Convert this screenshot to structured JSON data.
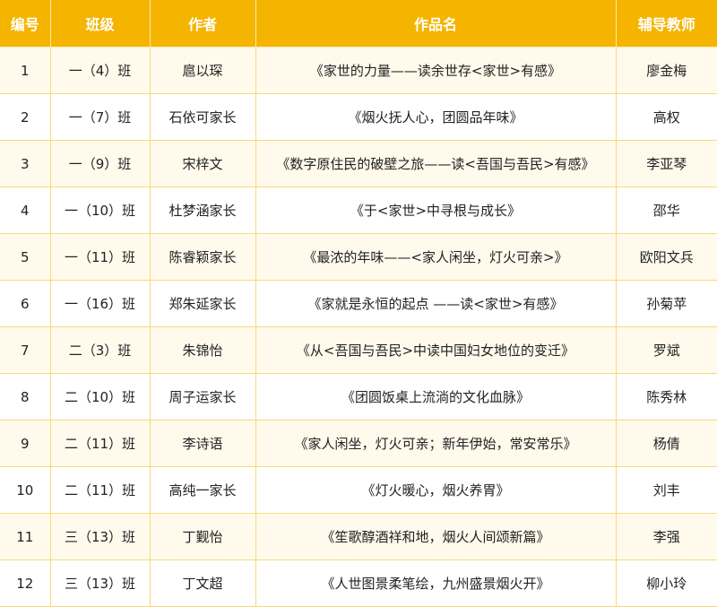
{
  "table": {
    "headers": [
      "编号",
      "班级",
      "作者",
      "作品名",
      "辅导教师"
    ],
    "rows": [
      [
        "1",
        "一（4）班",
        "扈以琛",
        "《家世的力量——读余世存<家世>有感》",
        "廖金梅"
      ],
      [
        "2",
        "一（7）班",
        "石依可家长",
        "《烟火抚人心，团圆品年味》",
        "高权"
      ],
      [
        "3",
        "一（9）班",
        "宋梓文",
        "《数字原住民的破壁之旅——读<吾国与吾民>有感》",
        "李亚琴"
      ],
      [
        "4",
        "一（10）班",
        "杜梦涵家长",
        "《于<家世>中寻根与成长》",
        "邵华"
      ],
      [
        "5",
        "一（11）班",
        "陈睿颖家长",
        "《最浓的年味——<家人闲坐，灯火可亲>》",
        "欧阳文兵"
      ],
      [
        "6",
        "一（16）班",
        "郑朱延家长",
        "《家就是永恒的起点 ——读<家世>有感》",
        "孙菊苹"
      ],
      [
        "7",
        "二（3）班",
        "朱锦怡",
        "《从<吾国与吾民>中读中国妇女地位的变迁》",
        "罗斌"
      ],
      [
        "8",
        "二（10）班",
        "周子运家长",
        "《团圆饭桌上流淌的文化血脉》",
        "陈秀林"
      ],
      [
        "9",
        "二（11）班",
        "李诗语",
        "《家人闲坐，灯火可亲；新年伊始，常安常乐》",
        "杨倩"
      ],
      [
        "10",
        "二（11）班",
        "高纯一家长",
        "《灯火暖心，烟火养胃》",
        "刘丰"
      ],
      [
        "11",
        "三（13）班",
        "丁觐怡",
        "《笙歌醇酒祥和地，烟火人间颂新篇》",
        "李强"
      ],
      [
        "12",
        "三（13）班",
        "丁文超",
        "《人世图景柔笔绘，九州盛景烟火开》",
        "柳小玲"
      ]
    ],
    "colors": {
      "header_bg": "#f4b400",
      "header_text": "#ffffff",
      "row_alt_bg": "#fffaec",
      "row_bg": "#ffffff",
      "border": "#f8d97a"
    }
  }
}
